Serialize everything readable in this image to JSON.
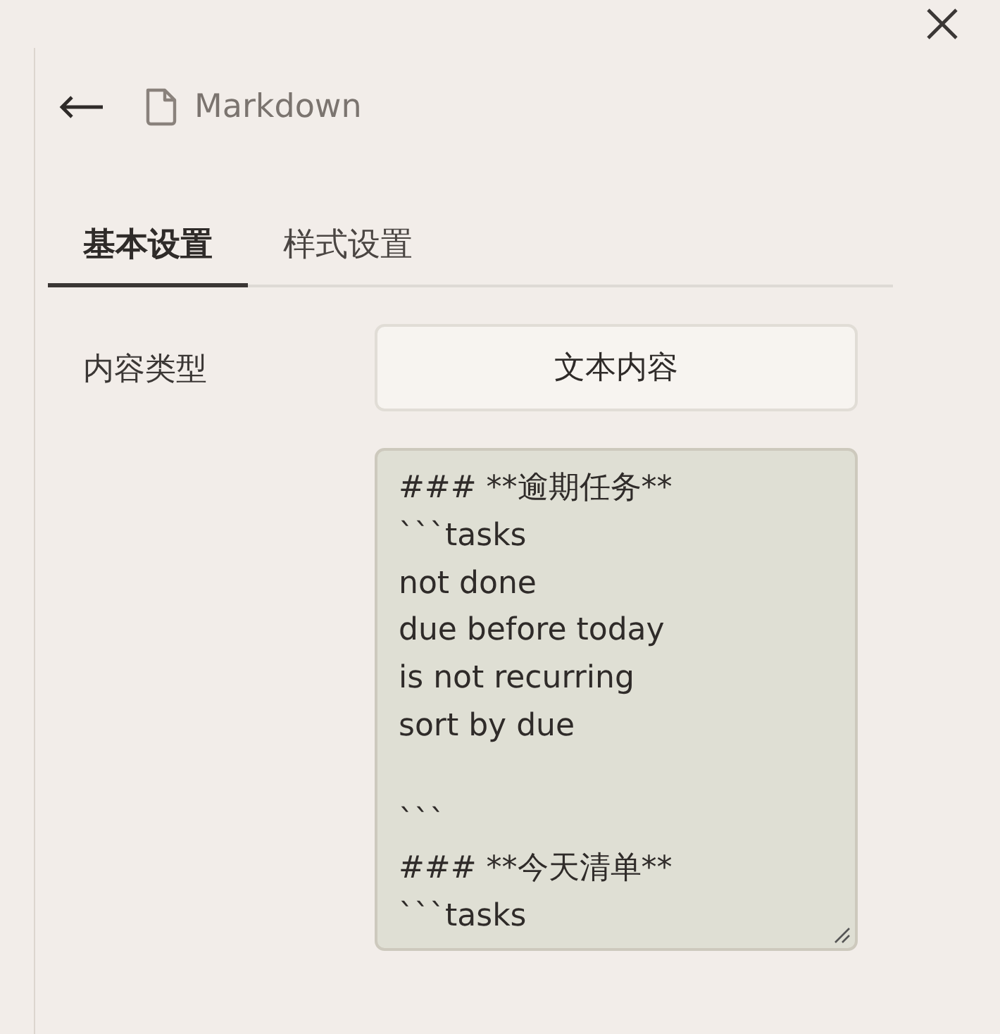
{
  "header": {
    "title": "Markdown"
  },
  "tabs": [
    {
      "label": "基本设置",
      "selected": true
    },
    {
      "label": "样式设置",
      "selected": false
    }
  ],
  "form": {
    "content_type": {
      "label": "内容类型",
      "value": "文本内容"
    },
    "content": {
      "value": "### **逾期任务**\n```tasks\nnot done\ndue before today\nis not recurring\nsort by due\n\n```\n### **今天清单**\n```tasks"
    }
  }
}
